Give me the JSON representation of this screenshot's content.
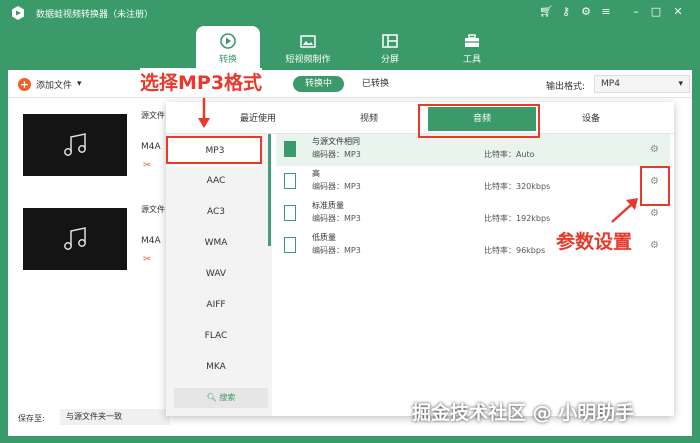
{
  "app": {
    "title": "数据蛙视频转换器（未注册）"
  },
  "nav": {
    "tabs": [
      {
        "label": "转换"
      },
      {
        "label": "短视频制作"
      },
      {
        "label": "分屏"
      },
      {
        "label": "工具"
      }
    ]
  },
  "toolbar": {
    "add_file_label": "添加文件",
    "converting_label": "转换中",
    "converted_label": "已转换",
    "output_format_label": "输出格式:",
    "output_format_value": "MP4"
  },
  "files": [
    {
      "source_label": "源文件",
      "format": "M4A"
    },
    {
      "source_label": "源文件",
      "format": "M4A"
    }
  ],
  "save": {
    "label": "保存至:",
    "value": "与源文件夹一致"
  },
  "popup": {
    "tabs": {
      "recent": "最近使用",
      "video": "视频",
      "audio": "音频",
      "device": "设备"
    },
    "formats": [
      "MP3",
      "AAC",
      "AC3",
      "WMA",
      "WAV",
      "AIFF",
      "FLAC",
      "MKA"
    ],
    "search_label": "搜索",
    "qualities": [
      {
        "name": "与源文件相同",
        "encoder": "编码器：MP3",
        "bitrate": "比特率：Auto"
      },
      {
        "name": "高",
        "encoder": "编码器：MP3",
        "bitrate": "比特率：320kbps"
      },
      {
        "name": "标准质量",
        "encoder": "编码器：MP3",
        "bitrate": "比特率：192kbps"
      },
      {
        "name": "低质量",
        "encoder": "编码器：MP3",
        "bitrate": "比特率：96kbps"
      }
    ]
  },
  "annotations": {
    "select_mp3": "选择MP3格式",
    "param_settings": "参数设置"
  },
  "watermark": "掘金技术社区 @ 小明助手",
  "colors": {
    "brand": "#3a9a6a",
    "annotation_red": "#e8392b",
    "accent_orange": "#f0602a"
  }
}
